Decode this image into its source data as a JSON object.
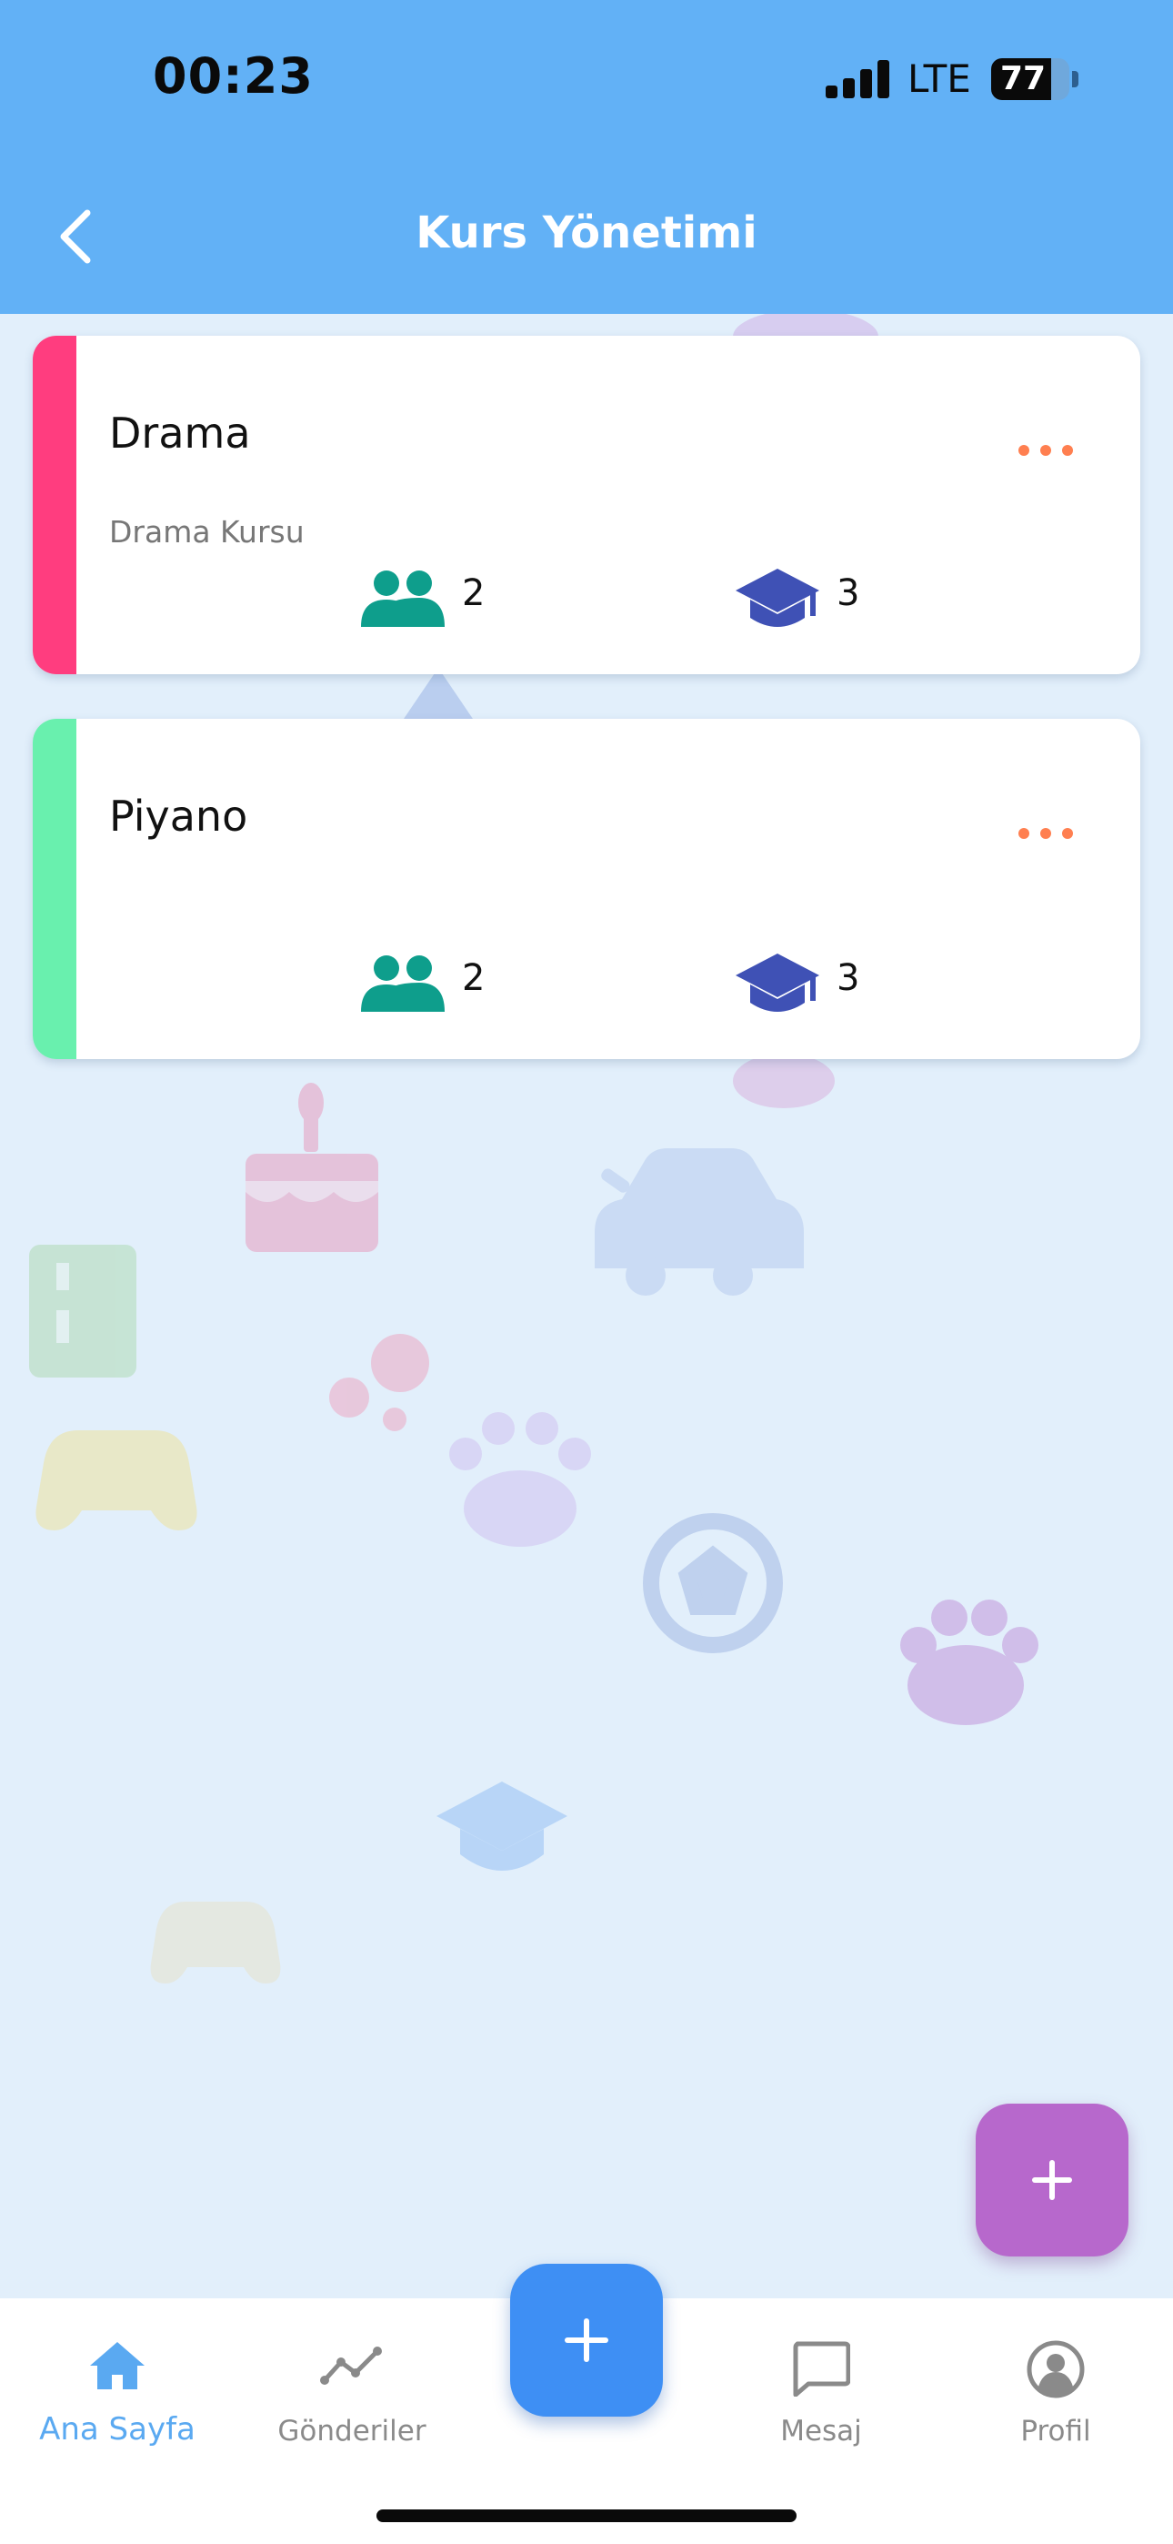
{
  "status_bar": {
    "time": "00:23",
    "network": "LTE",
    "battery": "77",
    "battery_level": 0.77
  },
  "header": {
    "title": "Kurs Yönetimi",
    "back_icon": "chevron-left-icon",
    "background": "#62b1f6"
  },
  "courses": [
    {
      "title": "Drama",
      "description": "Drama Kursu",
      "accent": "#ff3d7f",
      "students": "2",
      "teachers": "3",
      "menu_icon": "more-horizontal-icon"
    },
    {
      "title": "Piyano",
      "description": "",
      "accent": "#69f0ae",
      "students": "2",
      "teachers": "3",
      "menu_icon": "more-horizontal-icon"
    }
  ],
  "icons": {
    "students": "people-icon",
    "teachers": "graduation-cap-icon",
    "students_color": "#0e9e8c",
    "teachers_color": "#3f51b5",
    "menu_color": "#ff7f50"
  },
  "fab": {
    "secondary_icon": "plus-icon",
    "secondary_color": "#b768cc",
    "primary_icon": "plus-icon",
    "primary_color": "#3e8ff4"
  },
  "bottom_nav": {
    "items": [
      {
        "label": "Ana Sayfa",
        "icon": "home-icon",
        "active": true
      },
      {
        "label": "Gönderiler",
        "icon": "trending-icon",
        "active": false
      },
      {
        "label": "Mesaj",
        "icon": "message-icon",
        "active": false
      },
      {
        "label": "Profil",
        "icon": "profile-icon",
        "active": false
      }
    ],
    "active_color": "#5aa9f1",
    "inactive_color": "#8a8a8a"
  }
}
